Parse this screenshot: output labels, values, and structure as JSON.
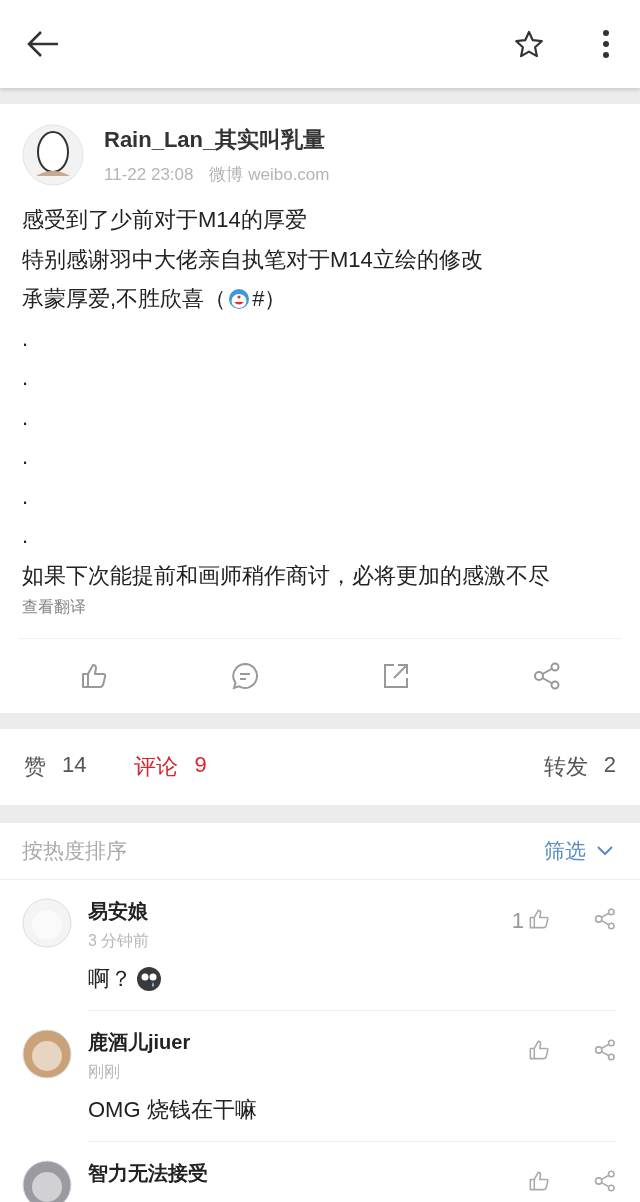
{
  "post": {
    "author": "Rain_Lan_其实叫乳量",
    "time": "11-22 23:08",
    "source": "微博 weibo.com",
    "lines": [
      [
        {
          "kind": "text",
          "text": "感受到了少前对于M14的厚爱"
        }
      ],
      [
        {
          "kind": "text",
          "text": "特别感谢羽中大佬亲自执笔对于M14立绘的修改"
        }
      ],
      [
        {
          "kind": "text",
          "text": "承蒙厚爱,不胜欣喜（"
        },
        {
          "kind": "emoji"
        },
        {
          "kind": "text",
          "text": "#）"
        }
      ],
      [
        {
          "kind": "text",
          "text": "."
        }
      ],
      [
        {
          "kind": "text",
          "text": "."
        }
      ],
      [
        {
          "kind": "text",
          "text": "."
        }
      ],
      [
        {
          "kind": "text",
          "text": "."
        }
      ],
      [
        {
          "kind": "text",
          "text": "."
        }
      ],
      [
        {
          "kind": "text",
          "text": "."
        }
      ],
      [
        {
          "kind": "text",
          "text": "如果下次能提前和画师稍作商讨，必将更加的感激不尽"
        }
      ]
    ],
    "translate": "查看翻译"
  },
  "stats": [
    {
      "label": "赞",
      "count": "14",
      "selected": false
    },
    {
      "label": "评论",
      "count": "9",
      "selected": true
    },
    {
      "label": "转发",
      "count": "2",
      "selected": false
    }
  ],
  "sort": {
    "label": "按热度排序",
    "filter": "筛选"
  },
  "comments": [
    {
      "name": "易安娘",
      "time": "3 分钟前",
      "body": [
        {
          "kind": "text",
          "text": "啊？"
        },
        {
          "kind": "emoji"
        }
      ],
      "likes": "1"
    },
    {
      "name": "鹿酒儿jiuer",
      "time": "刚刚",
      "body": [
        {
          "kind": "text",
          "text": "OMG 烧钱在干嘛"
        }
      ]
    },
    {
      "name": "智力无法接受"
    }
  ]
}
